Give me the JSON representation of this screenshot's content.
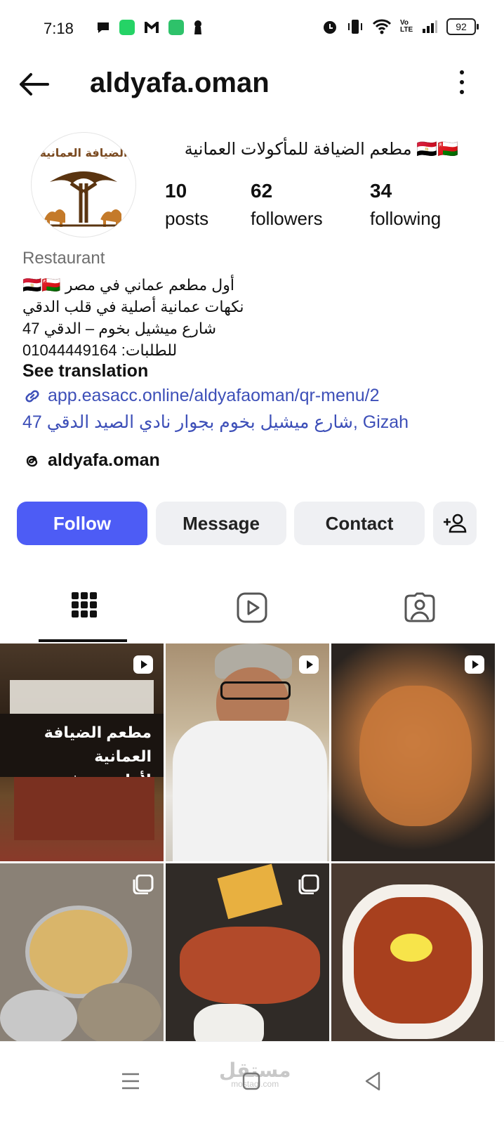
{
  "status": {
    "time": "7:18",
    "battery": "92",
    "network": "Vo LTE"
  },
  "header": {
    "username": "aldyafa.oman"
  },
  "profile": {
    "display_name": "مطعم الضيافة للمأكولات العمانية 🇪🇬🇴🇲",
    "avatar_text": "الضيافة العمانية",
    "stats": [
      {
        "value": "10",
        "label": "posts"
      },
      {
        "value": "62",
        "label": "followers"
      },
      {
        "value": "34",
        "label": "following"
      }
    ],
    "category": "Restaurant",
    "bio": [
      "🇪🇬🇴🇲 أول مطعم عماني في مصر",
      "نكهات عمانية أصلية في قلب الدقي",
      "شارع ميشيل بخوم – الدقي 47",
      "للطلبات: 01044449164"
    ],
    "see_translation": "See translation",
    "link": "app.easacc.online/aldyafaoman/qr-menu/2",
    "address": "47 شارع ميشيل بخوم بجوار نادي الصيد الدقي, Gizah",
    "threads_handle": "aldyafa.oman"
  },
  "actions": {
    "follow": "Follow",
    "message": "Message",
    "contact": "Contact"
  },
  "tabs": [
    "grid-icon",
    "reels-icon",
    "tagged-icon"
  ],
  "posts": [
    {
      "type": "reel",
      "caption": "مطعم الضيافة العمانية\nلأول مرة في مصر",
      "bg": "#3a2a1c"
    },
    {
      "type": "reel",
      "caption": "",
      "bg": "#b8a489"
    },
    {
      "type": "reel",
      "caption": "",
      "bg": "#2a2420"
    },
    {
      "type": "multi",
      "caption": "",
      "bg": "#7a6f62"
    },
    {
      "type": "multi",
      "caption": "",
      "bg": "#3a3530"
    },
    {
      "type": "none",
      "caption": "",
      "bg": "#5e4a3c"
    }
  ],
  "watermark": {
    "text": "مستقل",
    "sub": "mostaql.com"
  },
  "colors": {
    "accent": "#4d5cf5",
    "link": "#3d4fb8",
    "button_bg": "#eff0f3"
  }
}
